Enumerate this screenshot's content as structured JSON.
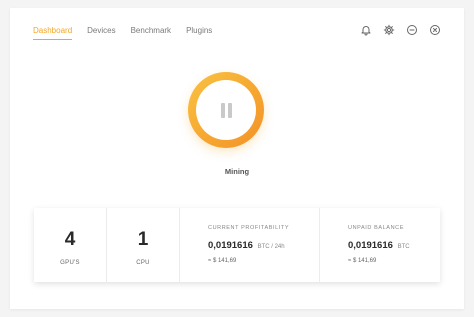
{
  "nav": {
    "tabs": [
      {
        "label": "Dashboard",
        "active": true
      },
      {
        "label": "Devices"
      },
      {
        "label": "Benchmark"
      },
      {
        "label": "Plugins"
      }
    ]
  },
  "top_icons": [
    "bell-icon",
    "gear-icon",
    "minimize-icon",
    "close-icon"
  ],
  "miner": {
    "status_label": "Mining",
    "button_icon": "pause-icon"
  },
  "stats": {
    "gpus": {
      "value": "4",
      "label": "GPU'S"
    },
    "cpu": {
      "value": "1",
      "label": "CPU"
    },
    "profitability": {
      "caption": "CURRENT PROFITABILITY",
      "value": "0,0191616",
      "unit": "BTC / 24h",
      "fiat": "≈ $ 141,69"
    },
    "balance": {
      "caption": "UNPAID BALANCE",
      "value": "0,0191616",
      "unit": "BTC",
      "fiat": "≈ $ 141,69"
    }
  },
  "colors": {
    "accent": "#f5a623",
    "text_dark": "#2a2a2a",
    "text_muted": "#888888"
  }
}
